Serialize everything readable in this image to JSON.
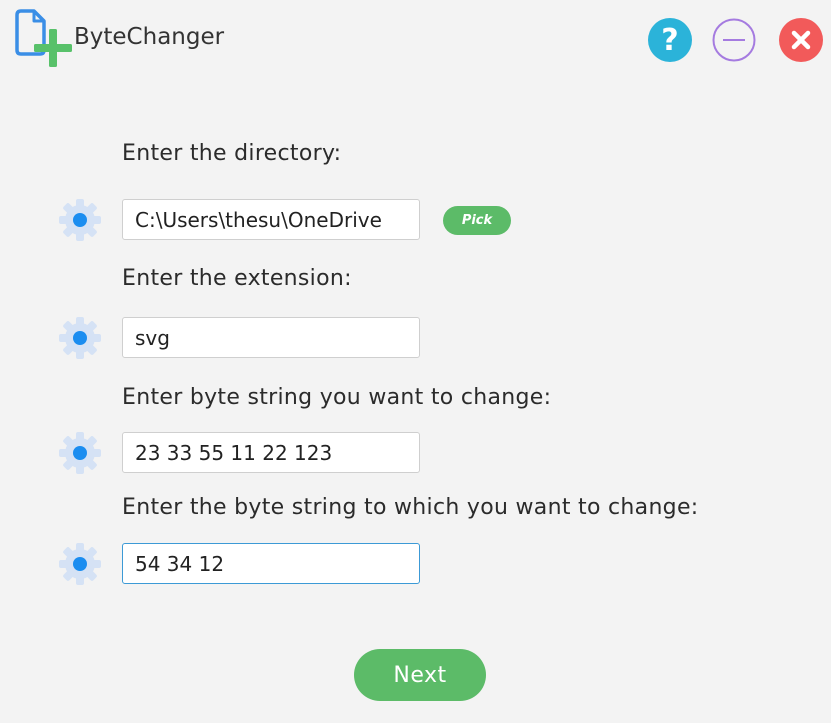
{
  "app": {
    "title": "ByteChanger",
    "logo_icon": "document-plus-icon",
    "window_buttons": [
      "help-icon",
      "minimize-icon",
      "close-icon"
    ]
  },
  "form": {
    "directory": {
      "label": "Enter the directory:",
      "value": "C:\\Users\\thesu\\OneDrive",
      "pick_label": "Pick"
    },
    "extension": {
      "label": "Enter the extension:",
      "value": "svg"
    },
    "byte_from": {
      "label": "Enter byte string you want to change:",
      "value": "23 33 55 11 22 123"
    },
    "byte_to": {
      "label": "Enter the byte string to which you want to change:",
      "value": "54 34 12"
    },
    "row_icon": "gear-icon"
  },
  "actions": {
    "next_label": "Next"
  },
  "colors": {
    "accent_green": "#5cbb68",
    "help_blue": "#2bb3d9",
    "minimize_purple": "#a57be0",
    "close_red": "#f25a5a",
    "gear_light": "#d5e2f5",
    "gear_dot": "#1b8df0",
    "focus_border": "#3c9ad6"
  }
}
